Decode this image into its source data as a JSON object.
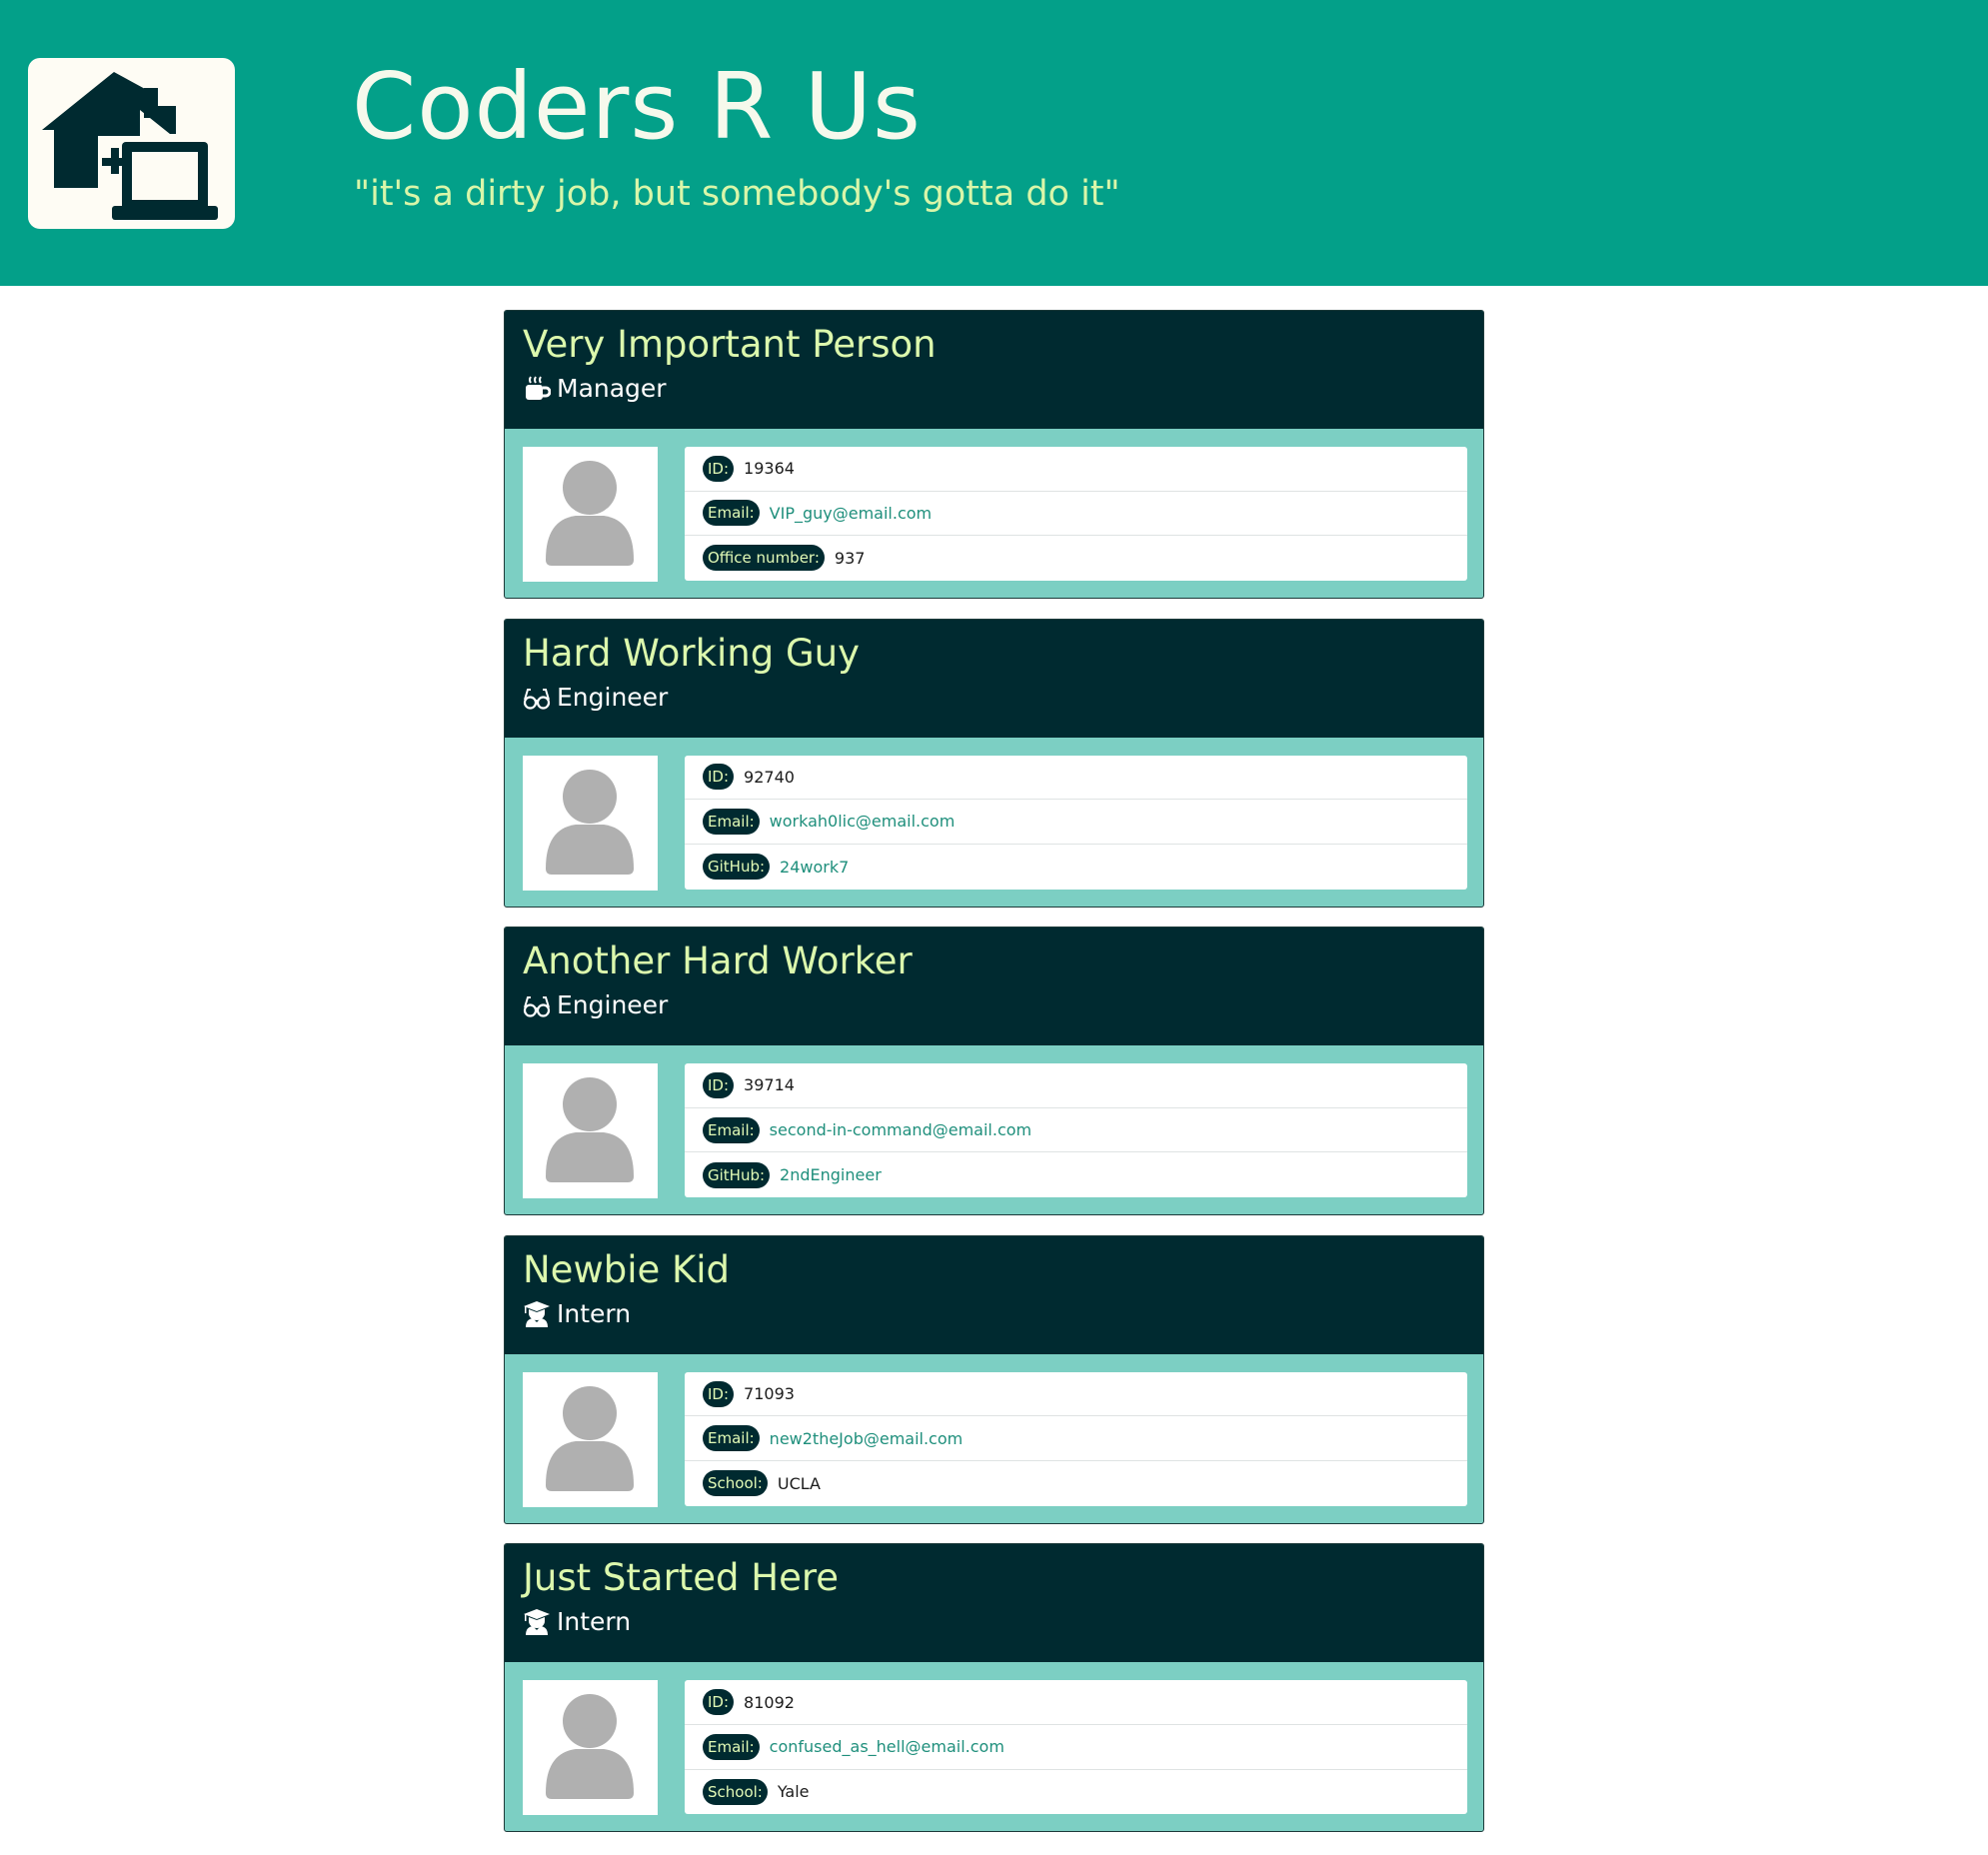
{
  "header": {
    "title": "Coders R Us",
    "tagline": "\"it's a dirty job, but somebody's gotta do it\"",
    "logo_icon": "house-laptop-icon",
    "background": "#03a089"
  },
  "employees": [
    {
      "name": "Very Important Person",
      "role": "Manager",
      "role_icon": "mug-hot-icon",
      "rows": [
        {
          "label": "ID:",
          "value": "19364"
        },
        {
          "label": "Email:",
          "value": "VIP_guy@email.com"
        },
        {
          "label": "Office number:",
          "value": "937"
        }
      ]
    },
    {
      "name": "Hard Working Guy",
      "role": "Engineer",
      "role_icon": "glasses-icon",
      "rows": [
        {
          "label": "ID:",
          "value": "92740"
        },
        {
          "label": "Email:",
          "value": "workah0lic@email.com"
        },
        {
          "label": "GitHub:",
          "value": "24work7"
        }
      ]
    },
    {
      "name": "Another Hard Worker",
      "role": "Engineer",
      "role_icon": "glasses-icon",
      "rows": [
        {
          "label": "ID:",
          "value": "39714"
        },
        {
          "label": "Email:",
          "value": "second-in-command@email.com"
        },
        {
          "label": "GitHub:",
          "value": "2ndEngineer"
        }
      ]
    },
    {
      "name": "Newbie Kid",
      "role": "Intern",
      "role_icon": "graduate-icon",
      "rows": [
        {
          "label": "ID:",
          "value": "71093"
        },
        {
          "label": "Email:",
          "value": "new2theJob@email.com"
        },
        {
          "label": "School:",
          "value": "UCLA"
        }
      ]
    },
    {
      "name": "Just Started Here",
      "role": "Intern",
      "role_icon": "graduate-icon",
      "rows": [
        {
          "label": "ID:",
          "value": "81092"
        },
        {
          "label": "Email:",
          "value": "confused_as_hell@email.com"
        },
        {
          "label": "School:",
          "value": "Yale"
        }
      ]
    }
  ]
}
